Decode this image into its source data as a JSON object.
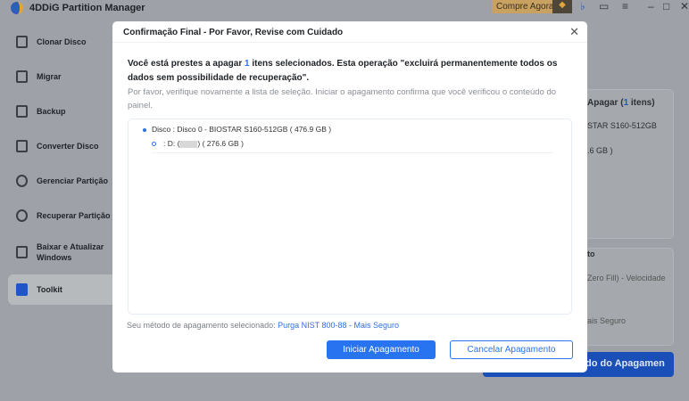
{
  "app": {
    "title": "4DDiG Partition Manager",
    "buy_label": "Compre Agora"
  },
  "sidebar": {
    "items": [
      {
        "label": "Clonar Disco"
      },
      {
        "label": "Migrar"
      },
      {
        "label": "Backup"
      },
      {
        "label": "Converter Disco"
      },
      {
        "label": "Gerenciar Partição"
      },
      {
        "label": "Recuperar Partição"
      },
      {
        "label": "Baixar e Atualizar Windows"
      },
      {
        "label": "Toolkit"
      }
    ]
  },
  "background": {
    "panel_title_prefix": "Apagar (",
    "panel_count": "1",
    "panel_title_suffix": " itens)",
    "disk_partial": "STAR S160-512GB",
    "size_partial": ".6 GB )",
    "section_partial": "to",
    "option1_partial": "Zero Fill) - Velocidade",
    "option2_partial": "ais Seguro",
    "button_partial": "do do Apagamen"
  },
  "dialog": {
    "title": "Confirmação Final - Por Favor, Revise com Cuidado",
    "warning_prefix": "Você está prestes a apagar ",
    "count": "1",
    "warning_suffix": " itens selecionados. Esta operação \"excluirá permanentemente todos os dados sem possibilidade de recuperação\".",
    "note": "Por favor, verifique novamente a lista de seleção. Iniciar o apagamento confirma que você verificou o conteúdo do painel.",
    "items": {
      "disk": "Disco : Disco 0 - BIOSTAR S160-512GB ( 476.9 GB )",
      "partition_prefix": ": D: (",
      "partition_suffix": ") ( 276.6 GB )"
    },
    "method_label": "Seu método de apagamento selecionado: ",
    "method_value": "Purga NIST 800-88 - Mais Seguro",
    "start_label": "Iniciar Apagamento",
    "cancel_label": "Cancelar Apagamento"
  }
}
